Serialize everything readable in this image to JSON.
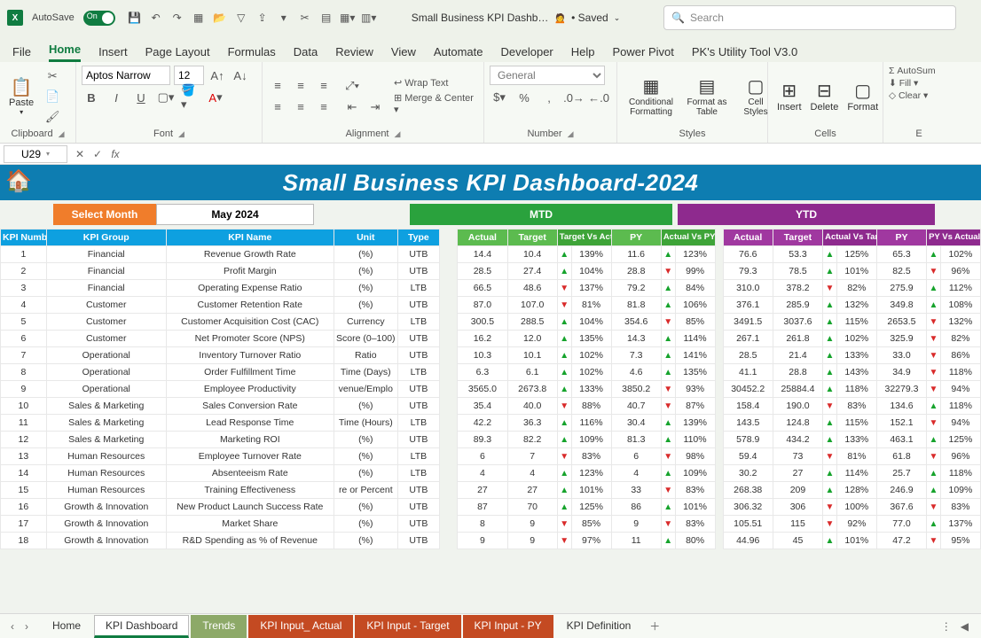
{
  "titlebar": {
    "autosave": "AutoSave",
    "autosave_state": "On",
    "doc": "Small Business KPI Dashb…",
    "saved": "• Saved",
    "search_placeholder": "Search"
  },
  "menu": [
    "File",
    "Home",
    "Insert",
    "Page Layout",
    "Formulas",
    "Data",
    "Review",
    "View",
    "Automate",
    "Developer",
    "Help",
    "Power Pivot",
    "PK's Utility Tool V3.0"
  ],
  "menu_active": 1,
  "ribbon": {
    "paste": "Paste",
    "clipboard": "Clipboard",
    "font_name": "Aptos Narrow",
    "font_size": "12",
    "font": "Font",
    "alignment": "Alignment",
    "wrap": "Wrap Text",
    "merge": "Merge & Center",
    "number_format": "General",
    "number": "Number",
    "cond": "Conditional Formatting",
    "fmt_table": "Format as Table",
    "cell_styles": "Cell Styles",
    "styles": "Styles",
    "insert": "Insert",
    "delete": "Delete",
    "format": "Format",
    "cells": "Cells",
    "autosum": "AutoSum",
    "fill": "Fill",
    "clear": "Clear"
  },
  "namebox": "U29",
  "dashboard": {
    "title": "Small Business KPI Dashboard-2024",
    "select_month_label": "Select Month",
    "select_month_value": "May 2024",
    "mtd": "MTD",
    "ytd": "YTD"
  },
  "headers": {
    "kpi_number": "KPI Number",
    "kpi_group": "KPI Group",
    "kpi_name": "KPI Name",
    "unit": "Unit",
    "type": "Type",
    "actual": "Actual",
    "target": "Target",
    "tva": "Target Vs Actual",
    "py": "PY",
    "avpy": "Actual Vs PY",
    "avt": "Actual Vs Target",
    "pyva": "PY Vs Actual"
  },
  "rows": [
    {
      "n": "1",
      "grp": "Financial",
      "name": "Revenue Growth Rate",
      "unit": "(%)",
      "type": "UTB",
      "m": {
        "a": "14.4",
        "t": "10.4",
        "tva": "139%",
        "tvaD": "up",
        "py": "11.6",
        "avp": "123%",
        "avpD": "up"
      },
      "y": {
        "a": "76.6",
        "t": "53.3",
        "avt": "125%",
        "avtD": "up",
        "py": "65.3",
        "pya": "102%",
        "pyaD": "up"
      }
    },
    {
      "n": "2",
      "grp": "Financial",
      "name": "Profit Margin",
      "unit": "(%)",
      "type": "UTB",
      "m": {
        "a": "28.5",
        "t": "27.4",
        "tva": "104%",
        "tvaD": "up",
        "py": "28.8",
        "avp": "99%",
        "avpD": "dn"
      },
      "y": {
        "a": "79.3",
        "t": "78.5",
        "avt": "101%",
        "avtD": "up",
        "py": "82.5",
        "pya": "96%",
        "pyaD": "dn"
      }
    },
    {
      "n": "3",
      "grp": "Financial",
      "name": "Operating Expense Ratio",
      "unit": "(%)",
      "type": "LTB",
      "m": {
        "a": "66.5",
        "t": "48.6",
        "tva": "137%",
        "tvaD": "dn",
        "py": "79.2",
        "avp": "84%",
        "avpD": "up"
      },
      "y": {
        "a": "310.0",
        "t": "378.2",
        "avt": "82%",
        "avtD": "dn",
        "py": "275.9",
        "pya": "112%",
        "pyaD": "up"
      }
    },
    {
      "n": "4",
      "grp": "Customer",
      "name": "Customer Retention Rate",
      "unit": "(%)",
      "type": "UTB",
      "m": {
        "a": "87.0",
        "t": "107.0",
        "tva": "81%",
        "tvaD": "dn",
        "py": "81.8",
        "avp": "106%",
        "avpD": "up"
      },
      "y": {
        "a": "376.1",
        "t": "285.9",
        "avt": "132%",
        "avtD": "up",
        "py": "349.8",
        "pya": "108%",
        "pyaD": "up"
      }
    },
    {
      "n": "5",
      "grp": "Customer",
      "name": "Customer Acquisition Cost (CAC)",
      "unit": "Currency",
      "type": "LTB",
      "m": {
        "a": "300.5",
        "t": "288.5",
        "tva": "104%",
        "tvaD": "up",
        "py": "354.6",
        "avp": "85%",
        "avpD": "dn"
      },
      "y": {
        "a": "3491.5",
        "t": "3037.6",
        "avt": "115%",
        "avtD": "up",
        "py": "2653.5",
        "pya": "132%",
        "pyaD": "dn"
      }
    },
    {
      "n": "6",
      "grp": "Customer",
      "name": "Net Promoter Score (NPS)",
      "unit": "Score (0–100)",
      "type": "UTB",
      "m": {
        "a": "16.2",
        "t": "12.0",
        "tva": "135%",
        "tvaD": "up",
        "py": "14.3",
        "avp": "114%",
        "avpD": "up"
      },
      "y": {
        "a": "267.1",
        "t": "261.8",
        "avt": "102%",
        "avtD": "up",
        "py": "325.9",
        "pya": "82%",
        "pyaD": "dn"
      }
    },
    {
      "n": "7",
      "grp": "Operational",
      "name": "Inventory Turnover Ratio",
      "unit": "Ratio",
      "type": "UTB",
      "m": {
        "a": "10.3",
        "t": "10.1",
        "tva": "102%",
        "tvaD": "up",
        "py": "7.3",
        "avp": "141%",
        "avpD": "up"
      },
      "y": {
        "a": "28.5",
        "t": "21.4",
        "avt": "133%",
        "avtD": "up",
        "py": "33.0",
        "pya": "86%",
        "pyaD": "dn"
      }
    },
    {
      "n": "8",
      "grp": "Operational",
      "name": "Order Fulfillment Time",
      "unit": "Time (Days)",
      "type": "LTB",
      "m": {
        "a": "6.3",
        "t": "6.1",
        "tva": "102%",
        "tvaD": "up",
        "py": "4.6",
        "avp": "135%",
        "avpD": "up"
      },
      "y": {
        "a": "41.1",
        "t": "28.8",
        "avt": "143%",
        "avtD": "up",
        "py": "34.9",
        "pya": "118%",
        "pyaD": "dn"
      }
    },
    {
      "n": "9",
      "grp": "Operational",
      "name": "Employee Productivity",
      "unit": "venue/Emplo",
      "type": "UTB",
      "m": {
        "a": "3565.0",
        "t": "2673.8",
        "tva": "133%",
        "tvaD": "up",
        "py": "3850.2",
        "avp": "93%",
        "avpD": "dn"
      },
      "y": {
        "a": "30452.2",
        "t": "25884.4",
        "avt": "118%",
        "avtD": "up",
        "py": "32279.3",
        "pya": "94%",
        "pyaD": "dn"
      }
    },
    {
      "n": "10",
      "grp": "Sales & Marketing",
      "name": "Sales Conversion Rate",
      "unit": "(%)",
      "type": "UTB",
      "m": {
        "a": "35.4",
        "t": "40.0",
        "tva": "88%",
        "tvaD": "dn",
        "py": "40.7",
        "avp": "87%",
        "avpD": "dn"
      },
      "y": {
        "a": "158.4",
        "t": "190.0",
        "avt": "83%",
        "avtD": "dn",
        "py": "134.6",
        "pya": "118%",
        "pyaD": "up"
      }
    },
    {
      "n": "11",
      "grp": "Sales & Marketing",
      "name": "Lead Response Time",
      "unit": "Time (Hours)",
      "type": "LTB",
      "m": {
        "a": "42.2",
        "t": "36.3",
        "tva": "116%",
        "tvaD": "up",
        "py": "30.4",
        "avp": "139%",
        "avpD": "up"
      },
      "y": {
        "a": "143.5",
        "t": "124.8",
        "avt": "115%",
        "avtD": "up",
        "py": "152.1",
        "pya": "94%",
        "pyaD": "dn"
      }
    },
    {
      "n": "12",
      "grp": "Sales & Marketing",
      "name": "Marketing ROI",
      "unit": "(%)",
      "type": "UTB",
      "m": {
        "a": "89.3",
        "t": "82.2",
        "tva": "109%",
        "tvaD": "up",
        "py": "81.3",
        "avp": "110%",
        "avpD": "up"
      },
      "y": {
        "a": "578.9",
        "t": "434.2",
        "avt": "133%",
        "avtD": "up",
        "py": "463.1",
        "pya": "125%",
        "pyaD": "up"
      }
    },
    {
      "n": "13",
      "grp": "Human Resources",
      "name": "Employee Turnover Rate",
      "unit": "(%)",
      "type": "LTB",
      "m": {
        "a": "6",
        "t": "7",
        "tva": "83%",
        "tvaD": "dn",
        "py": "6",
        "avp": "98%",
        "avpD": "dn"
      },
      "y": {
        "a": "59.4",
        "t": "73",
        "avt": "81%",
        "avtD": "dn",
        "py": "61.8",
        "pya": "96%",
        "pyaD": "dn"
      }
    },
    {
      "n": "14",
      "grp": "Human Resources",
      "name": "Absenteeism Rate",
      "unit": "(%)",
      "type": "LTB",
      "m": {
        "a": "4",
        "t": "4",
        "tva": "123%",
        "tvaD": "up",
        "py": "4",
        "avp": "109%",
        "avpD": "up"
      },
      "y": {
        "a": "30.2",
        "t": "27",
        "avt": "114%",
        "avtD": "up",
        "py": "25.7",
        "pya": "118%",
        "pyaD": "up"
      }
    },
    {
      "n": "15",
      "grp": "Human Resources",
      "name": "Training Effectiveness",
      "unit": "re or Percent",
      "type": "UTB",
      "m": {
        "a": "27",
        "t": "27",
        "tva": "101%",
        "tvaD": "up",
        "py": "33",
        "avp": "83%",
        "avpD": "dn"
      },
      "y": {
        "a": "268.38",
        "t": "209",
        "avt": "128%",
        "avtD": "up",
        "py": "246.9",
        "pya": "109%",
        "pyaD": "up"
      }
    },
    {
      "n": "16",
      "grp": "Growth & Innovation",
      "name": "New Product Launch Success Rate",
      "unit": "(%)",
      "type": "UTB",
      "m": {
        "a": "87",
        "t": "70",
        "tva": "125%",
        "tvaD": "up",
        "py": "86",
        "avp": "101%",
        "avpD": "up"
      },
      "y": {
        "a": "306.32",
        "t": "306",
        "avt": "100%",
        "avtD": "dn",
        "py": "367.6",
        "pya": "83%",
        "pyaD": "dn"
      }
    },
    {
      "n": "17",
      "grp": "Growth & Innovation",
      "name": "Market Share",
      "unit": "(%)",
      "type": "UTB",
      "m": {
        "a": "8",
        "t": "9",
        "tva": "85%",
        "tvaD": "dn",
        "py": "9",
        "avp": "83%",
        "avpD": "dn"
      },
      "y": {
        "a": "105.51",
        "t": "115",
        "avt": "92%",
        "avtD": "dn",
        "py": "77.0",
        "pya": "137%",
        "pyaD": "up"
      }
    },
    {
      "n": "18",
      "grp": "Growth & Innovation",
      "name": "R&D Spending as % of Revenue",
      "unit": "(%)",
      "type": "UTB",
      "m": {
        "a": "9",
        "t": "9",
        "tva": "97%",
        "tvaD": "dn",
        "py": "11",
        "avp": "80%",
        "avpD": "up"
      },
      "y": {
        "a": "44.96",
        "t": "45",
        "avt": "101%",
        "avtD": "up",
        "py": "47.2",
        "pya": "95%",
        "pyaD": "dn"
      }
    }
  ],
  "sheets": [
    "Home",
    "KPI Dashboard",
    "Trends",
    "KPI Input_ Actual",
    "KPI Input - Target",
    "KPI Input - PY",
    "KPI Definition"
  ],
  "sheet_active": 1
}
